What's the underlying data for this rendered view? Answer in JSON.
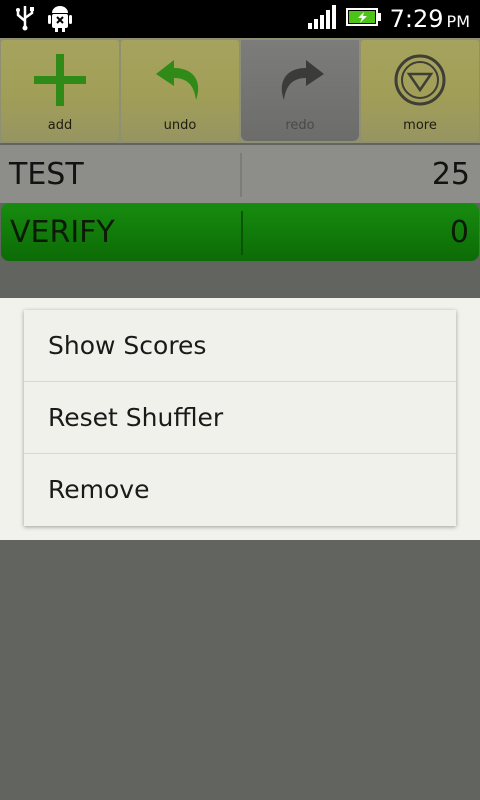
{
  "status_bar": {
    "time": "7:29",
    "ampm": "PM",
    "icons": [
      "usb-icon",
      "android-debug-icon",
      "signal-icon",
      "battery-charging-icon"
    ]
  },
  "toolbar": {
    "buttons": [
      {
        "label": "add",
        "icon": "plus-icon",
        "enabled": true
      },
      {
        "label": "undo",
        "icon": "undo-icon",
        "enabled": true
      },
      {
        "label": "redo",
        "icon": "redo-icon",
        "enabled": false
      },
      {
        "label": "more",
        "icon": "more-icon",
        "enabled": true
      }
    ]
  },
  "list": {
    "rows": [
      {
        "name": "TEST",
        "score": "25"
      },
      {
        "name": "VERIFY",
        "score": "0"
      }
    ]
  },
  "context_menu": {
    "items": [
      "Show Scores",
      "Reset Shuffler",
      "Remove"
    ]
  },
  "colors": {
    "accent_green": "#178c0f",
    "toolbar_olive": "#a6a35e",
    "menu_bg": "#f1f1eb"
  }
}
